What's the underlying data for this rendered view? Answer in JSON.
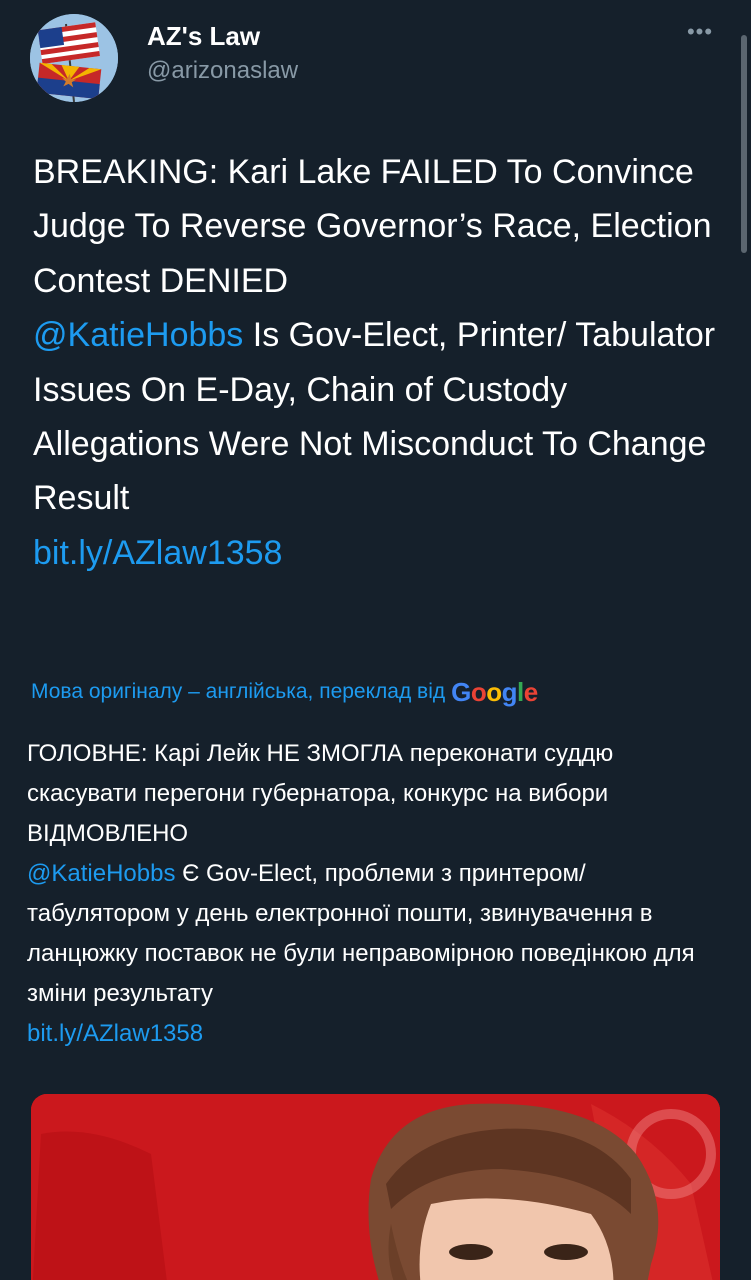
{
  "account": {
    "display_name": "AZ's Law",
    "handle": "@arizonaslaw",
    "avatar_icon": "flags-avatar-icon"
  },
  "menu": {
    "more_label": "•••"
  },
  "tweet": {
    "text_part1": "BREAKING: Kari Lake FAILED To Convince Judge To Reverse Governor’s Race, Election Contest DENIED",
    "mention": "@KatieHobbs",
    "text_part2": " Is Gov-Elect, Printer/ Tabulator Issues On E-Day, Chain of Custody Allegations Were Not Misconduct To Change Result",
    "link": "bit.ly/AZlaw1358"
  },
  "translation": {
    "label": "Мова оригіналу – англійська, переклад від",
    "provider_letters": [
      "G",
      "o",
      "o",
      "g",
      "l",
      "e"
    ],
    "text_part1": "ГОЛОВНЕ: Карі Лейк НЕ ЗМОГЛА переконати суддю скасувати перегони губернатора, конкурс на вибори ВІДМОВЛЕНО",
    "mention": "@KatieHobbs",
    "text_part2": " Є Gov-Elect, проблеми з принтером/ табулятором у день електронної пошти, звинувачення в ланцюжку поставок не були неправомірною поведінкою для зміни результату",
    "link": "bit.ly/AZlaw1358"
  },
  "colors": {
    "background": "#15202b",
    "link": "#1d9bf0",
    "secondary_text": "#8899a6",
    "media_red": "#c4151a"
  }
}
